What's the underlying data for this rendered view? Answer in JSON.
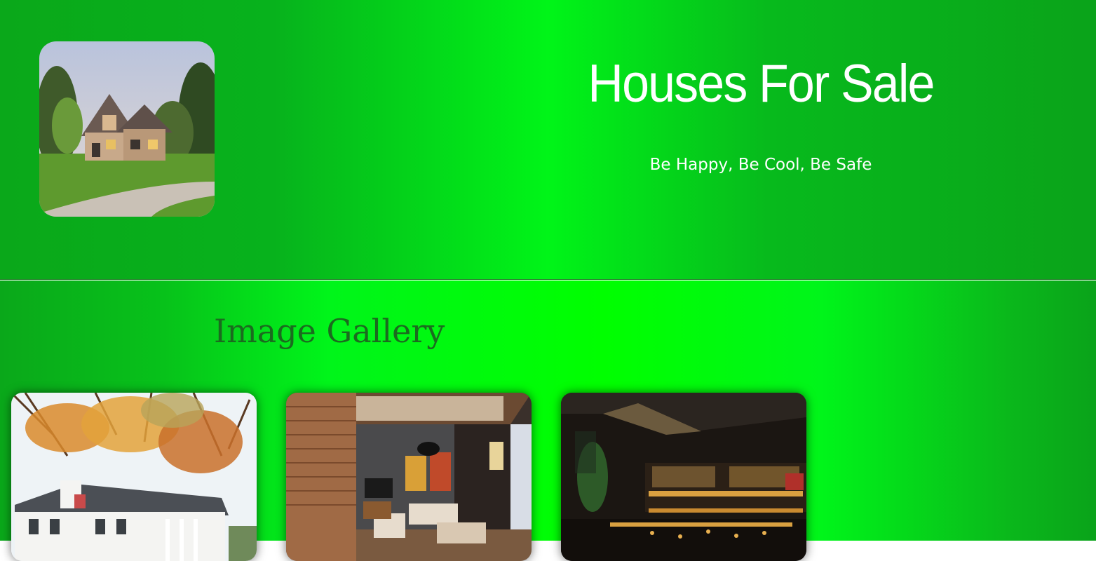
{
  "header": {
    "title": "Houses For Sale",
    "tagline": "Be Happy, Be Cool, Be Safe",
    "logo_icon": "house-photo"
  },
  "gallery": {
    "heading": "Image Gallery",
    "images": [
      {
        "icon": "white-house-autumn-photo"
      },
      {
        "icon": "living-room-photo"
      },
      {
        "icon": "bar-interior-photo"
      }
    ]
  },
  "colors": {
    "header_edge": "#0aa81a",
    "header_center": "#00f518",
    "gallery_center": "#00ff00",
    "heading_text": "#1b6b1f",
    "title_text": "#ffffff"
  }
}
